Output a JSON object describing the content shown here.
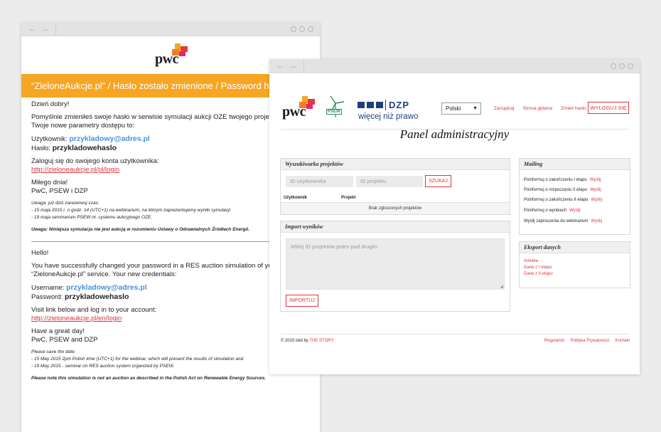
{
  "email": {
    "banner": "“ZieloneAukcje.pl” / Hasło zostało zmienione / Password has bee",
    "pl": {
      "greeting": "Dzień dobry!",
      "intro_1": "Pomyślnie zmieniłeś swoje hasło w serwisie symulacji aukcji OZE twojego projektu “Ziel",
      "intro_2": "Twoje nowe parametry dostępu to:",
      "user_label": "Użytkownik: ",
      "user_value": "przykladowy@adres.pl",
      "pass_label": "Hasło: ",
      "pass_value": "przykladowehaslo",
      "login_text": "Zaloguj się do swojego konta użytkownika:",
      "login_link": "http://zieloneaukcje.pl/pl/login",
      "bye": "Miłego dnia!",
      "sign": "PwC, PSEW i DZP",
      "note_1": "Uwaga: już dziś zarezerwuj czas:",
      "note_2": "- 15 maja 2015 r. o godz. 14 (UTC+1) na webinarium, na którym zaprezentujemy wyniki symulacji",
      "note_3": "- 19 maja seminarium PSEW nt. systemu aukcyjnego OZE.",
      "warning": "Uwaga: Niniejsza symulacja nie jest aukcją w rozumieniu Ustawy o Odnawialnych Źródłach Energii."
    },
    "en": {
      "greeting": "Hello!",
      "intro_1": "You have successfully changed your password in a RES auction simulation of your proje",
      "intro_2": "“ZieloneAukcje.pl” service. Your new credentials:",
      "user_label": "Username: ",
      "user_value": "przykladowy@adres.pl",
      "pass_label": "Password: ",
      "pass_value": "przykladowehaslo",
      "login_text": "Visit link below and log in to your account:",
      "login_link": "http://zieloneaukcje.pl/en/login",
      "bye": "Have a great day!",
      "sign": "PwC, PSEW and DZP",
      "note_1": "Please save the date:",
      "note_2": "- 15 May 2015 2pm Polish time (UTC+1) for the webinar, which will present the results of simulation and",
      "note_3": "- 19 May 2015 - seminar on RES auction system organized by PSEW.",
      "warning": "Please note this simulation is not an auction as described in the Polish Act on Renewable Energy Sources."
    }
  },
  "logos": {
    "pwc": "pwc",
    "psew": "PSEW",
    "dzp_name": "DZP",
    "dzp_tag": "więcej niż prawo"
  },
  "admin": {
    "language": "Polski",
    "nav": [
      "Zarządzaj",
      "Strona główna",
      "Zmień hasło"
    ],
    "logout": "WYLOGUJ SIĘ",
    "title": "Panel administracyjny",
    "search": {
      "heading": "Wyszukiwarka projektów",
      "user_placeholder": "ID użytkownika",
      "project_placeholder": "ID projektu",
      "button": "SZUKAJ",
      "col_user": "Użytkownik",
      "col_project": "Projekt",
      "empty": "Brak zgłoszonych projektów"
    },
    "import": {
      "heading": "Import wyników",
      "placeholder": "Wklej ID projektów jeden pod drugim",
      "button": "IMPORTUJ"
    },
    "mailing": {
      "heading": "Mailing",
      "send": "Wyślij",
      "items": [
        "Poinformuj o zakończeniu I etapu",
        "Poinformuj o rozpoczęciu II etapu",
        "Poinformuj o zakończeniu II etapu",
        "Poinformuj o wynikach",
        "Wyślij zaproszenia do webinarium"
      ]
    },
    "export": {
      "heading": "Eksport danych",
      "items": [
        "Ankieta",
        "Dane z I etapu",
        "Dane z II etapu"
      ]
    },
    "footer": {
      "copy": "© 2015 told by ",
      "studio": "THE STORY",
      "links": [
        "Regulamin",
        "Polityka Prywatności",
        "Kontakt"
      ]
    }
  }
}
